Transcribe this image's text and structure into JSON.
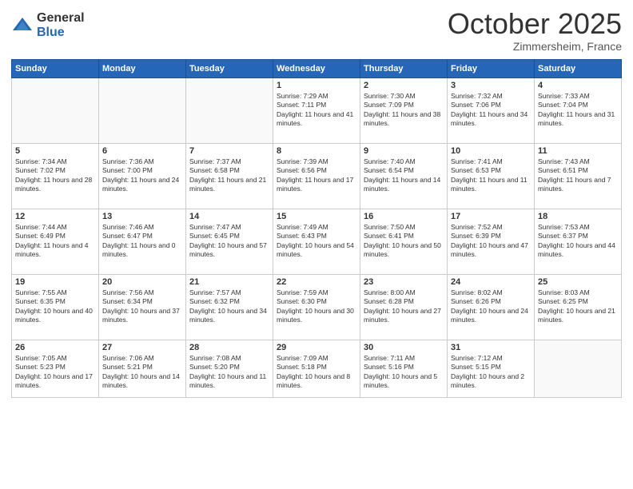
{
  "logo": {
    "general": "General",
    "blue": "Blue"
  },
  "header": {
    "month": "October 2025",
    "location": "Zimmersheim, France"
  },
  "weekdays": [
    "Sunday",
    "Monday",
    "Tuesday",
    "Wednesday",
    "Thursday",
    "Friday",
    "Saturday"
  ],
  "weeks": [
    [
      {
        "day": "",
        "sunrise": "",
        "sunset": "",
        "daylight": ""
      },
      {
        "day": "",
        "sunrise": "",
        "sunset": "",
        "daylight": ""
      },
      {
        "day": "",
        "sunrise": "",
        "sunset": "",
        "daylight": ""
      },
      {
        "day": "1",
        "sunrise": "Sunrise: 7:29 AM",
        "sunset": "Sunset: 7:11 PM",
        "daylight": "Daylight: 11 hours and 41 minutes."
      },
      {
        "day": "2",
        "sunrise": "Sunrise: 7:30 AM",
        "sunset": "Sunset: 7:09 PM",
        "daylight": "Daylight: 11 hours and 38 minutes."
      },
      {
        "day": "3",
        "sunrise": "Sunrise: 7:32 AM",
        "sunset": "Sunset: 7:06 PM",
        "daylight": "Daylight: 11 hours and 34 minutes."
      },
      {
        "day": "4",
        "sunrise": "Sunrise: 7:33 AM",
        "sunset": "Sunset: 7:04 PM",
        "daylight": "Daylight: 11 hours and 31 minutes."
      }
    ],
    [
      {
        "day": "5",
        "sunrise": "Sunrise: 7:34 AM",
        "sunset": "Sunset: 7:02 PM",
        "daylight": "Daylight: 11 hours and 28 minutes."
      },
      {
        "day": "6",
        "sunrise": "Sunrise: 7:36 AM",
        "sunset": "Sunset: 7:00 PM",
        "daylight": "Daylight: 11 hours and 24 minutes."
      },
      {
        "day": "7",
        "sunrise": "Sunrise: 7:37 AM",
        "sunset": "Sunset: 6:58 PM",
        "daylight": "Daylight: 11 hours and 21 minutes."
      },
      {
        "day": "8",
        "sunrise": "Sunrise: 7:39 AM",
        "sunset": "Sunset: 6:56 PM",
        "daylight": "Daylight: 11 hours and 17 minutes."
      },
      {
        "day": "9",
        "sunrise": "Sunrise: 7:40 AM",
        "sunset": "Sunset: 6:54 PM",
        "daylight": "Daylight: 11 hours and 14 minutes."
      },
      {
        "day": "10",
        "sunrise": "Sunrise: 7:41 AM",
        "sunset": "Sunset: 6:53 PM",
        "daylight": "Daylight: 11 hours and 11 minutes."
      },
      {
        "day": "11",
        "sunrise": "Sunrise: 7:43 AM",
        "sunset": "Sunset: 6:51 PM",
        "daylight": "Daylight: 11 hours and 7 minutes."
      }
    ],
    [
      {
        "day": "12",
        "sunrise": "Sunrise: 7:44 AM",
        "sunset": "Sunset: 6:49 PM",
        "daylight": "Daylight: 11 hours and 4 minutes."
      },
      {
        "day": "13",
        "sunrise": "Sunrise: 7:46 AM",
        "sunset": "Sunset: 6:47 PM",
        "daylight": "Daylight: 11 hours and 0 minutes."
      },
      {
        "day": "14",
        "sunrise": "Sunrise: 7:47 AM",
        "sunset": "Sunset: 6:45 PM",
        "daylight": "Daylight: 10 hours and 57 minutes."
      },
      {
        "day": "15",
        "sunrise": "Sunrise: 7:49 AM",
        "sunset": "Sunset: 6:43 PM",
        "daylight": "Daylight: 10 hours and 54 minutes."
      },
      {
        "day": "16",
        "sunrise": "Sunrise: 7:50 AM",
        "sunset": "Sunset: 6:41 PM",
        "daylight": "Daylight: 10 hours and 50 minutes."
      },
      {
        "day": "17",
        "sunrise": "Sunrise: 7:52 AM",
        "sunset": "Sunset: 6:39 PM",
        "daylight": "Daylight: 10 hours and 47 minutes."
      },
      {
        "day": "18",
        "sunrise": "Sunrise: 7:53 AM",
        "sunset": "Sunset: 6:37 PM",
        "daylight": "Daylight: 10 hours and 44 minutes."
      }
    ],
    [
      {
        "day": "19",
        "sunrise": "Sunrise: 7:55 AM",
        "sunset": "Sunset: 6:35 PM",
        "daylight": "Daylight: 10 hours and 40 minutes."
      },
      {
        "day": "20",
        "sunrise": "Sunrise: 7:56 AM",
        "sunset": "Sunset: 6:34 PM",
        "daylight": "Daylight: 10 hours and 37 minutes."
      },
      {
        "day": "21",
        "sunrise": "Sunrise: 7:57 AM",
        "sunset": "Sunset: 6:32 PM",
        "daylight": "Daylight: 10 hours and 34 minutes."
      },
      {
        "day": "22",
        "sunrise": "Sunrise: 7:59 AM",
        "sunset": "Sunset: 6:30 PM",
        "daylight": "Daylight: 10 hours and 30 minutes."
      },
      {
        "day": "23",
        "sunrise": "Sunrise: 8:00 AM",
        "sunset": "Sunset: 6:28 PM",
        "daylight": "Daylight: 10 hours and 27 minutes."
      },
      {
        "day": "24",
        "sunrise": "Sunrise: 8:02 AM",
        "sunset": "Sunset: 6:26 PM",
        "daylight": "Daylight: 10 hours and 24 minutes."
      },
      {
        "day": "25",
        "sunrise": "Sunrise: 8:03 AM",
        "sunset": "Sunset: 6:25 PM",
        "daylight": "Daylight: 10 hours and 21 minutes."
      }
    ],
    [
      {
        "day": "26",
        "sunrise": "Sunrise: 7:05 AM",
        "sunset": "Sunset: 5:23 PM",
        "daylight": "Daylight: 10 hours and 17 minutes."
      },
      {
        "day": "27",
        "sunrise": "Sunrise: 7:06 AM",
        "sunset": "Sunset: 5:21 PM",
        "daylight": "Daylight: 10 hours and 14 minutes."
      },
      {
        "day": "28",
        "sunrise": "Sunrise: 7:08 AM",
        "sunset": "Sunset: 5:20 PM",
        "daylight": "Daylight: 10 hours and 11 minutes."
      },
      {
        "day": "29",
        "sunrise": "Sunrise: 7:09 AM",
        "sunset": "Sunset: 5:18 PM",
        "daylight": "Daylight: 10 hours and 8 minutes."
      },
      {
        "day": "30",
        "sunrise": "Sunrise: 7:11 AM",
        "sunset": "Sunset: 5:16 PM",
        "daylight": "Daylight: 10 hours and 5 minutes."
      },
      {
        "day": "31",
        "sunrise": "Sunrise: 7:12 AM",
        "sunset": "Sunset: 5:15 PM",
        "daylight": "Daylight: 10 hours and 2 minutes."
      },
      {
        "day": "",
        "sunrise": "",
        "sunset": "",
        "daylight": ""
      }
    ]
  ]
}
